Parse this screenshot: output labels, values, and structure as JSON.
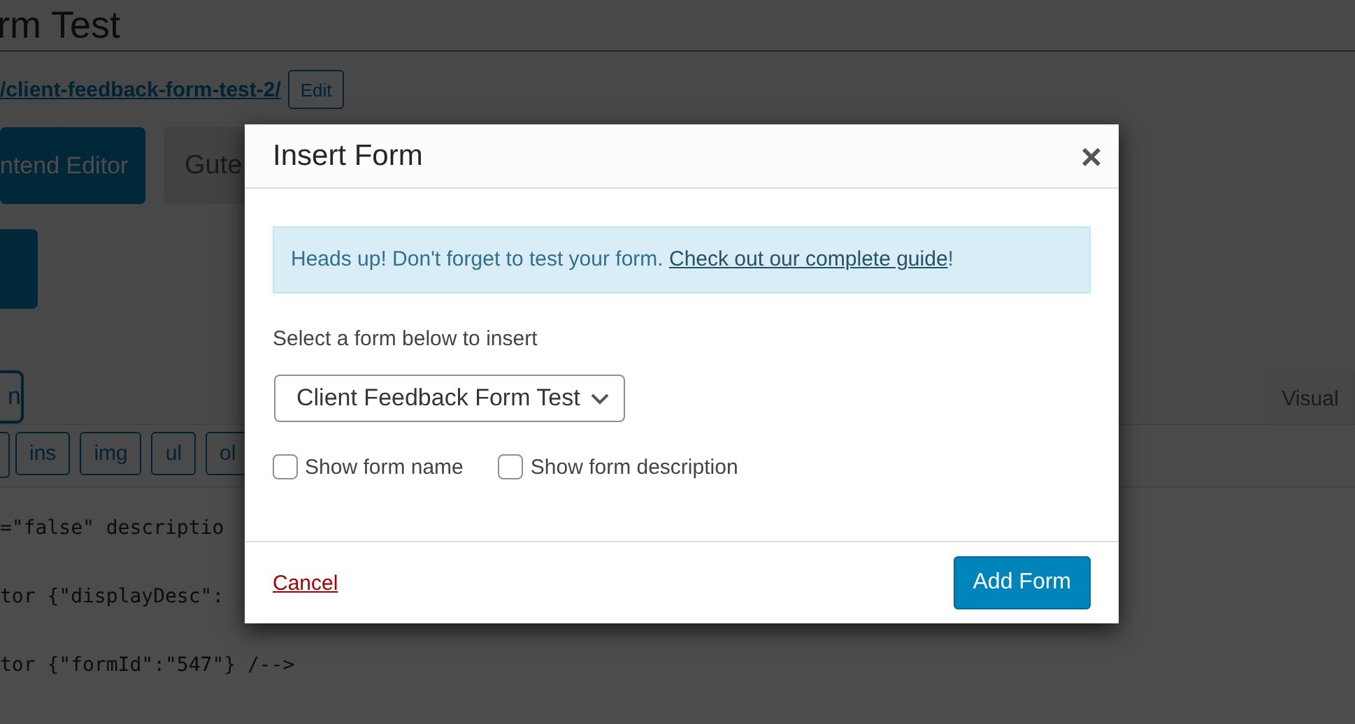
{
  "page": {
    "title": "rm Test",
    "permalink": "/client-feedback-form-test-2/",
    "edit_button": "Edit",
    "editor_buttons": [
      {
        "label": "ntend Editor",
        "kind": "primary"
      },
      {
        "label": "Gute",
        "kind": "secondary"
      }
    ],
    "add_form_button": "n",
    "editor_tabs": [
      {
        "label": "Visual",
        "selected": false
      }
    ],
    "quicktags": [
      "ins",
      "img",
      "ul",
      "ol"
    ],
    "code_lines": [
      "=\"false\" descriptio",
      "tor {\"displayDesc\":",
      "tor {\"formId\":\"547\"} /-->"
    ]
  },
  "modal": {
    "title": "Insert Form",
    "close": "×",
    "notice": {
      "text": "Heads up! Don't forget to test your form. ",
      "link": "Check out our complete guide",
      "end": "!"
    },
    "select_label": "Select a form below to insert",
    "form_select": {
      "value": "Client Feedback Form Test"
    },
    "options": [
      {
        "label": "Show form name",
        "checked": false
      },
      {
        "label": "Show form description",
        "checked": false
      }
    ],
    "cancel": "Cancel",
    "submit": "Add Form"
  }
}
